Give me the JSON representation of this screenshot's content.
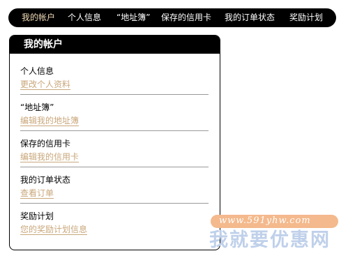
{
  "nav": {
    "items": [
      {
        "label": "我的帐户",
        "active": true
      },
      {
        "label": "个人信息"
      },
      {
        "label": "“地址簿”"
      },
      {
        "label": "保存的信用卡"
      },
      {
        "label": "我的订单状态"
      },
      {
        "label": "奖励计划"
      }
    ]
  },
  "panel": {
    "title": "我的帐户",
    "sections": [
      {
        "title": "个人信息",
        "link": "更改个人资料"
      },
      {
        "title": "“地址簿”",
        "link": "编辑我的地址簿"
      },
      {
        "title": "保存的信用卡",
        "link": "编辑我的信用卡"
      },
      {
        "title": "我的订单状态",
        "link": "查看订单"
      },
      {
        "title": "奖励计划",
        "link": "您的奖励计划信息"
      }
    ]
  },
  "watermark": {
    "url": "www.591yhw.com",
    "text": "我就要优惠网"
  },
  "colors": {
    "nav_bg": "#000000",
    "active_nav": "#f2dcb8",
    "link": "#c9a77b"
  }
}
